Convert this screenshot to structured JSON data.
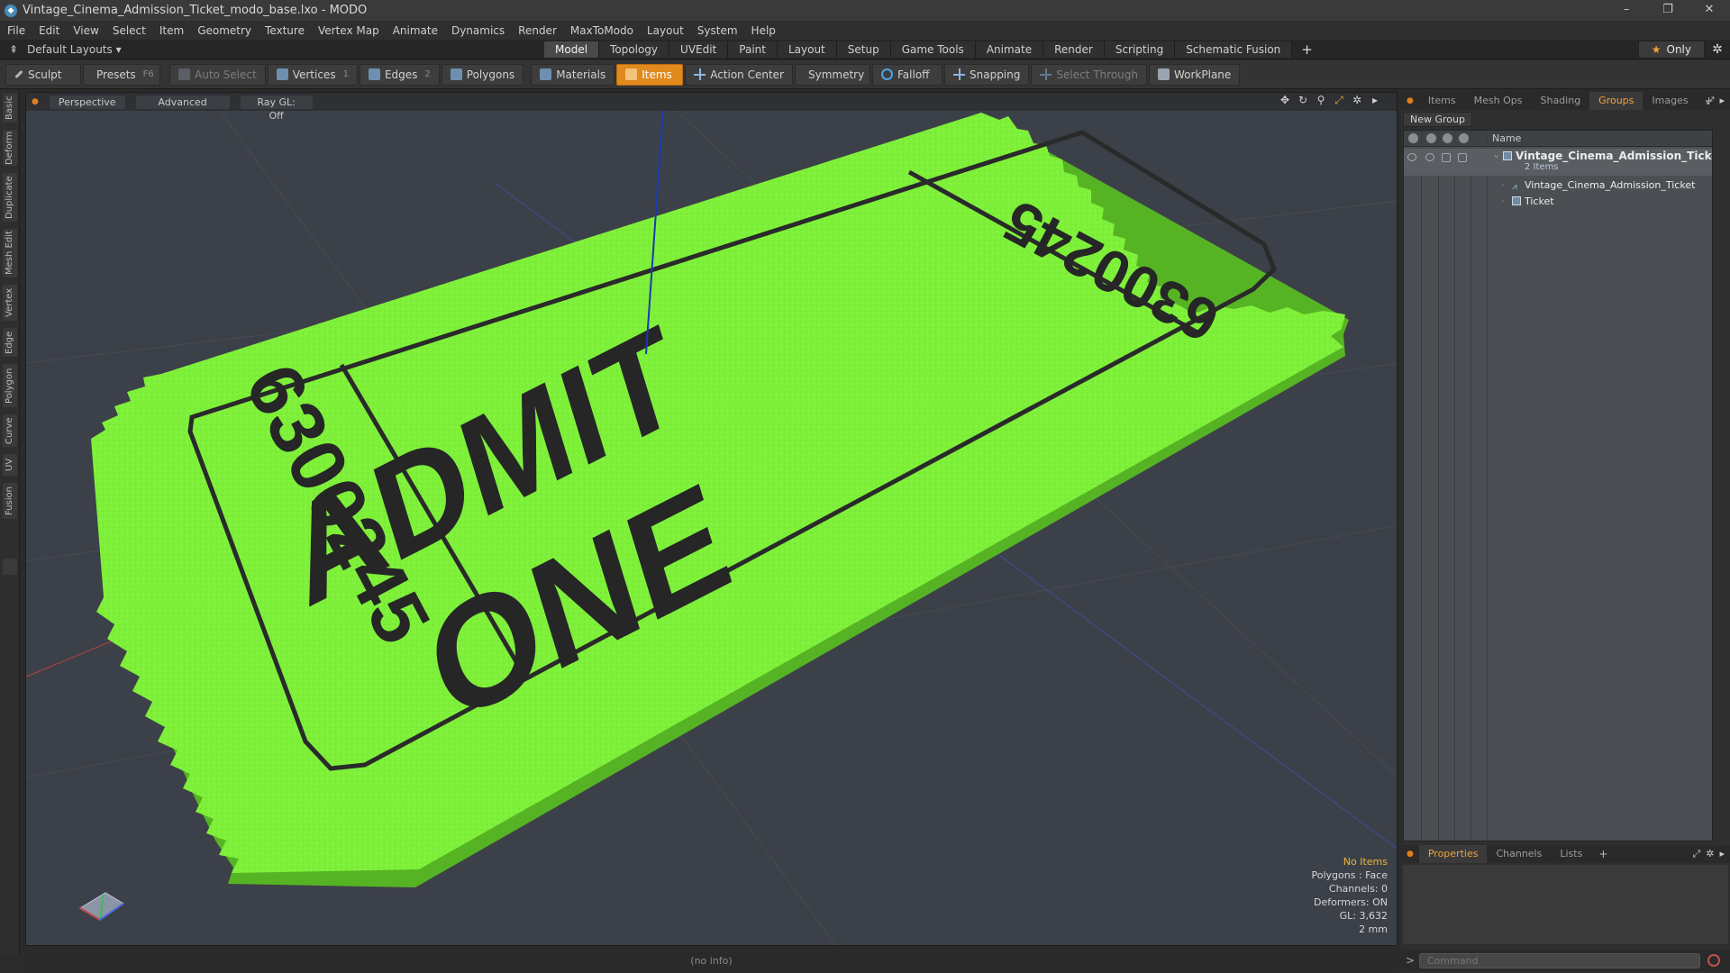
{
  "window": {
    "title": "Vintage_Cinema_Admission_Ticket_modo_base.lxo - MODO",
    "controls": [
      "–",
      "❐",
      "✕"
    ]
  },
  "menu": [
    "File",
    "Edit",
    "View",
    "Select",
    "Item",
    "Geometry",
    "Texture",
    "Vertex Map",
    "Animate",
    "Dynamics",
    "Render",
    "MaxToModo",
    "Layout",
    "System",
    "Help"
  ],
  "layout_bar": {
    "layouts_label": "Default Layouts ▾",
    "tabs": [
      "Model",
      "Topology",
      "UVEdit",
      "Paint",
      "Layout",
      "Setup",
      "Game Tools",
      "Animate",
      "Render",
      "Scripting",
      "Schematic Fusion"
    ],
    "active_tab": "Model",
    "only_label": "Only"
  },
  "toolbar": {
    "sculpt": "Sculpt",
    "presets": "Presets",
    "presets_shortcut": "F6",
    "auto_select": "Auto Select",
    "vertices": "Vertices",
    "vertices_count": "1",
    "edges": "Edges",
    "edges_count": "2",
    "polygons": "Polygons",
    "materials": "Materials",
    "items": "Items",
    "action_center": "Action Center",
    "symmetry": "Symmetry",
    "falloff": "Falloff",
    "snapping": "Snapping",
    "select_through": "Select Through",
    "workplane": "WorkPlane"
  },
  "left_tabs": [
    "Basic",
    "Deform",
    "Duplicate",
    "Mesh Edit",
    "Vertex",
    "Edge",
    "Polygon",
    "Curve",
    "UV",
    "Fusion"
  ],
  "viewport": {
    "view_mode": "Perspective",
    "shading": "Advanced",
    "raygl": "Ray GL: Off",
    "ticket": {
      "color": "#7ef03a",
      "headline": "ADMIT",
      "subline": "ONE",
      "serial": "6300245",
      "serial_top": "6300245"
    },
    "info": {
      "selection": "No Items",
      "polygons": "Polygons : Face",
      "channels": "Channels: 0",
      "deformers": "Deformers: ON",
      "gl": "GL: 3,632",
      "scale": "2 mm"
    }
  },
  "status": "(no info)",
  "right_panel": {
    "tabs": [
      "Items",
      "Mesh Ops",
      "Shading",
      "Groups",
      "Images"
    ],
    "active_tab": "Groups",
    "new_group": "New Group",
    "column_name": "Name",
    "tree": {
      "group_name": "Vintage_Cinema_Admission_Ticket",
      "group_count": "2 Items",
      "children": [
        "Vintage_Cinema_Admission_Ticket",
        "Ticket"
      ]
    }
  },
  "properties": {
    "tabs": [
      "Properties",
      "Channels",
      "Lists"
    ],
    "active_tab": "Properties"
  },
  "command": {
    "placeholder": "Command"
  }
}
